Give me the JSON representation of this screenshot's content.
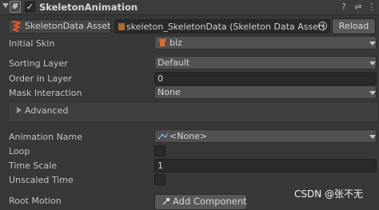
{
  "component": {
    "title": "SkeletonAnimation",
    "enabled": true,
    "script_icon": "#"
  },
  "header_buttons": [
    {
      "icon": "help-icon",
      "glyph": "?"
    },
    {
      "icon": "preset-icon",
      "glyph": "⇌"
    },
    {
      "icon": "more-icon",
      "glyph": "⋮"
    }
  ],
  "skeleton_data": {
    "label": "SkeletonData Asset",
    "value": "skeleton_SkeletonData (Skeleton Data Asset)",
    "reload_label": "Reload"
  },
  "fields": {
    "initial_skin": {
      "label": "Initial Skin",
      "value": "blz"
    },
    "sorting_layer": {
      "label": "Sorting Layer",
      "value": "Default"
    },
    "order_in_layer": {
      "label": "Order in Layer",
      "value": "0"
    },
    "mask_interaction": {
      "label": "Mask Interaction",
      "value": "None"
    },
    "advanced": {
      "label": "Advanced"
    },
    "animation_name": {
      "label": "Animation Name",
      "value": "<None>"
    },
    "loop": {
      "label": "Loop",
      "checked": false
    },
    "time_scale": {
      "label": "Time Scale",
      "value": "1"
    },
    "unscaled_time": {
      "label": "Unscaled Time",
      "checked": false
    },
    "root_motion": {
      "label": "Root Motion"
    }
  },
  "add_component_label": "Add Component",
  "watermark": "CSDN @张不无",
  "colors": {
    "background": "#383838",
    "field": "#2a2a2a",
    "dropdown": "#515151",
    "button": "#585858",
    "spine_orange": "#e0582a"
  }
}
